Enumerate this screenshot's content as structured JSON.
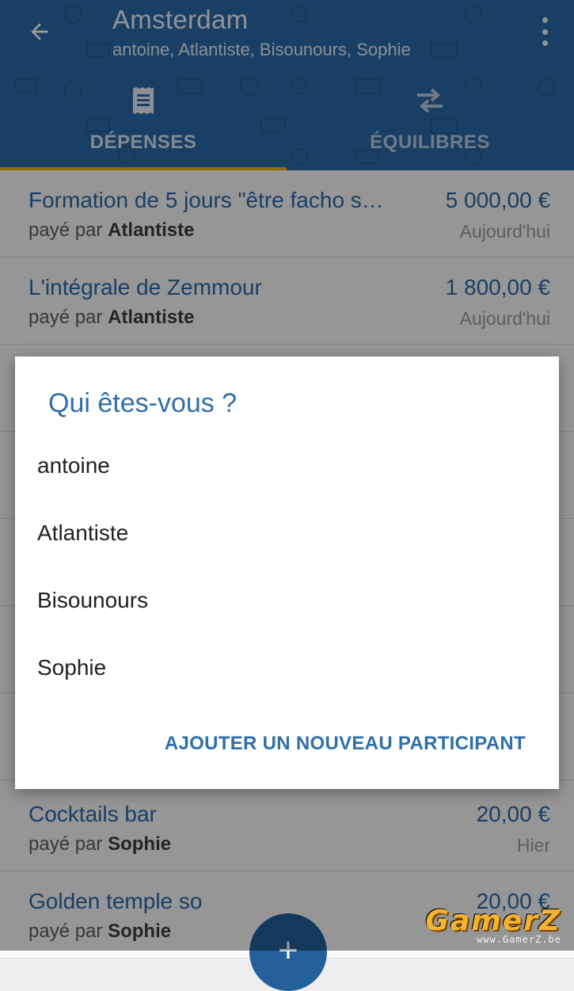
{
  "header": {
    "title": "Amsterdam",
    "subtitle": "antoine, Atlantiste, Bisounours, Sophie",
    "back_icon": "arrow-left-icon",
    "menu_icon": "more-vert-icon",
    "brand_color": "#2c6aa8",
    "indicator_color": "#f0b400"
  },
  "tabs": [
    {
      "label": "DÉPENSES",
      "icon": "receipt-icon",
      "active": true
    },
    {
      "label": "ÉQUILIBRES",
      "icon": "swap-arrows-icon",
      "active": false
    }
  ],
  "expenses": [
    {
      "title": "Formation de 5 jours \"être facho s…",
      "amount": "5 000,00 €",
      "payer_prefix": "payé par",
      "payer": "Atlantiste",
      "date": "Aujourd'hui"
    },
    {
      "title": "L'intégrale de Zemmour",
      "amount": "1 800,00 €",
      "payer_prefix": "payé par",
      "payer": "Atlantiste",
      "date": "Aujourd'hui"
    },
    {
      "title": "Cocktails bar",
      "amount": "20,00 €",
      "payer_prefix": "payé par",
      "payer": "Sophie",
      "date": "Hier"
    },
    {
      "title": "Golden temple so",
      "amount": "20,00 €",
      "payer_prefix": "payé par",
      "payer": "Sophie",
      "date": ""
    }
  ],
  "fab": {
    "label": "+",
    "icon": "add-icon"
  },
  "dialog": {
    "title": "Qui êtes-vous ?",
    "options": [
      "antoine",
      "Atlantiste",
      "Bisounours",
      "Sophie"
    ],
    "action_label": "AJOUTER UN NOUVEAU PARTICIPANT"
  },
  "watermark": {
    "logo": "GamerZ",
    "url": "www.GamerZ.be"
  }
}
